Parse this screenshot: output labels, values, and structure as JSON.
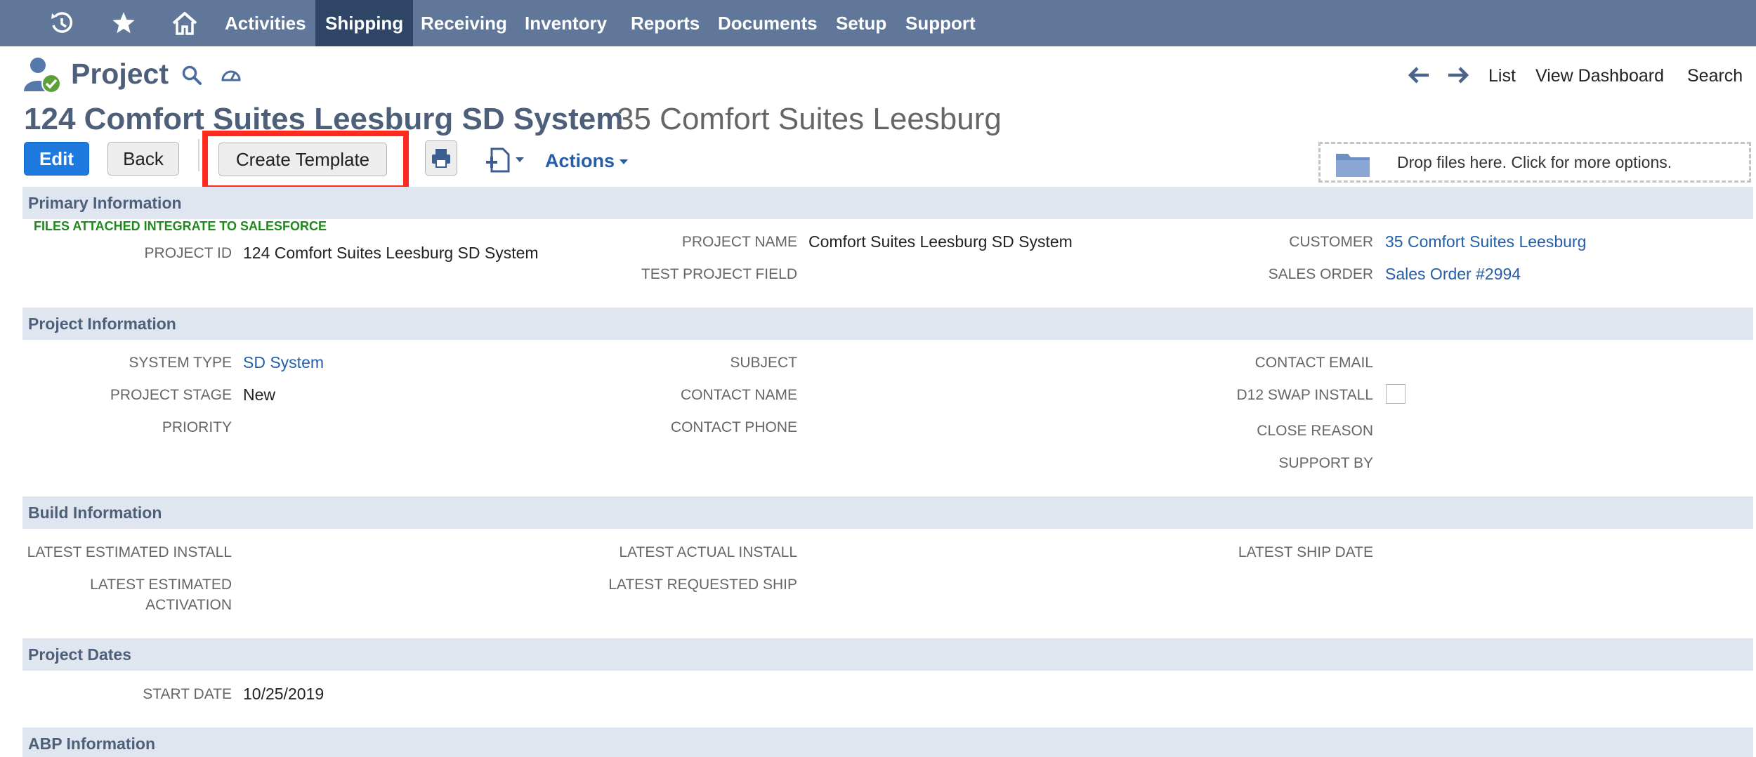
{
  "nav": {
    "items": [
      "Activities",
      "Shipping",
      "Receiving",
      "Inventory",
      "Reports",
      "Documents",
      "Setup",
      "Support"
    ],
    "active": "Shipping",
    "icons": [
      "recent-icon",
      "star-icon",
      "home-icon"
    ]
  },
  "header": {
    "record_type": "Project",
    "links": {
      "list": "List",
      "dashboard": "View Dashboard",
      "search": "Search"
    },
    "title": "124 Comfort Suites Leesburg SD System",
    "subtitle": "35 Comfort Suites Leesburg"
  },
  "toolbar": {
    "edit": "Edit",
    "back": "Back",
    "create_template": "Create Template",
    "actions": "Actions",
    "dropzone": "Drop files here. Click for more options."
  },
  "sections": {
    "primary": {
      "title": "Primary Information",
      "note": "FILES ATTACHED INTEGRATE TO SALESFORCE",
      "project_id_label": "PROJECT ID",
      "project_id": "124 Comfort Suites Leesburg SD System",
      "project_name_label": "PROJECT NAME",
      "project_name": "Comfort Suites Leesburg SD System",
      "test_field_label": "TEST PROJECT FIELD",
      "customer_label": "CUSTOMER",
      "customer": "35 Comfort Suites Leesburg",
      "sales_order_label": "SALES ORDER",
      "sales_order": "Sales Order #2994"
    },
    "project": {
      "title": "Project Information",
      "system_type_label": "SYSTEM TYPE",
      "system_type": "SD System",
      "stage_label": "PROJECT STAGE",
      "stage": "New",
      "priority_label": "PRIORITY",
      "subject_label": "SUBJECT",
      "contact_name_label": "CONTACT NAME",
      "contact_phone_label": "CONTACT PHONE",
      "contact_email_label": "CONTACT EMAIL",
      "swap_label": "D12 SWAP INSTALL",
      "swap_checked": false,
      "close_reason_label": "CLOSE REASON",
      "support_by_label": "SUPPORT BY"
    },
    "build": {
      "title": "Build Information",
      "est_install_label": "LATEST ESTIMATED INSTALL",
      "est_activation_label_1": "LATEST ESTIMATED",
      "est_activation_label_2": "ACTIVATION",
      "actual_install_label": "LATEST ACTUAL INSTALL",
      "requested_ship_label": "LATEST REQUESTED SHIP",
      "ship_date_label": "LATEST SHIP DATE"
    },
    "dates": {
      "title": "Project Dates",
      "start_date_label": "START DATE",
      "start_date": "10/25/2019"
    },
    "abp": {
      "title": "ABP Information"
    }
  },
  "colors": {
    "nav_bg": "#607799",
    "nav_active": "#2e4566",
    "section_bg": "#e0e6ef",
    "link": "#255ea8",
    "primary_button": "#1f7ae0",
    "highlight": "#ff2a1d",
    "note_green": "#1e8a1e"
  }
}
